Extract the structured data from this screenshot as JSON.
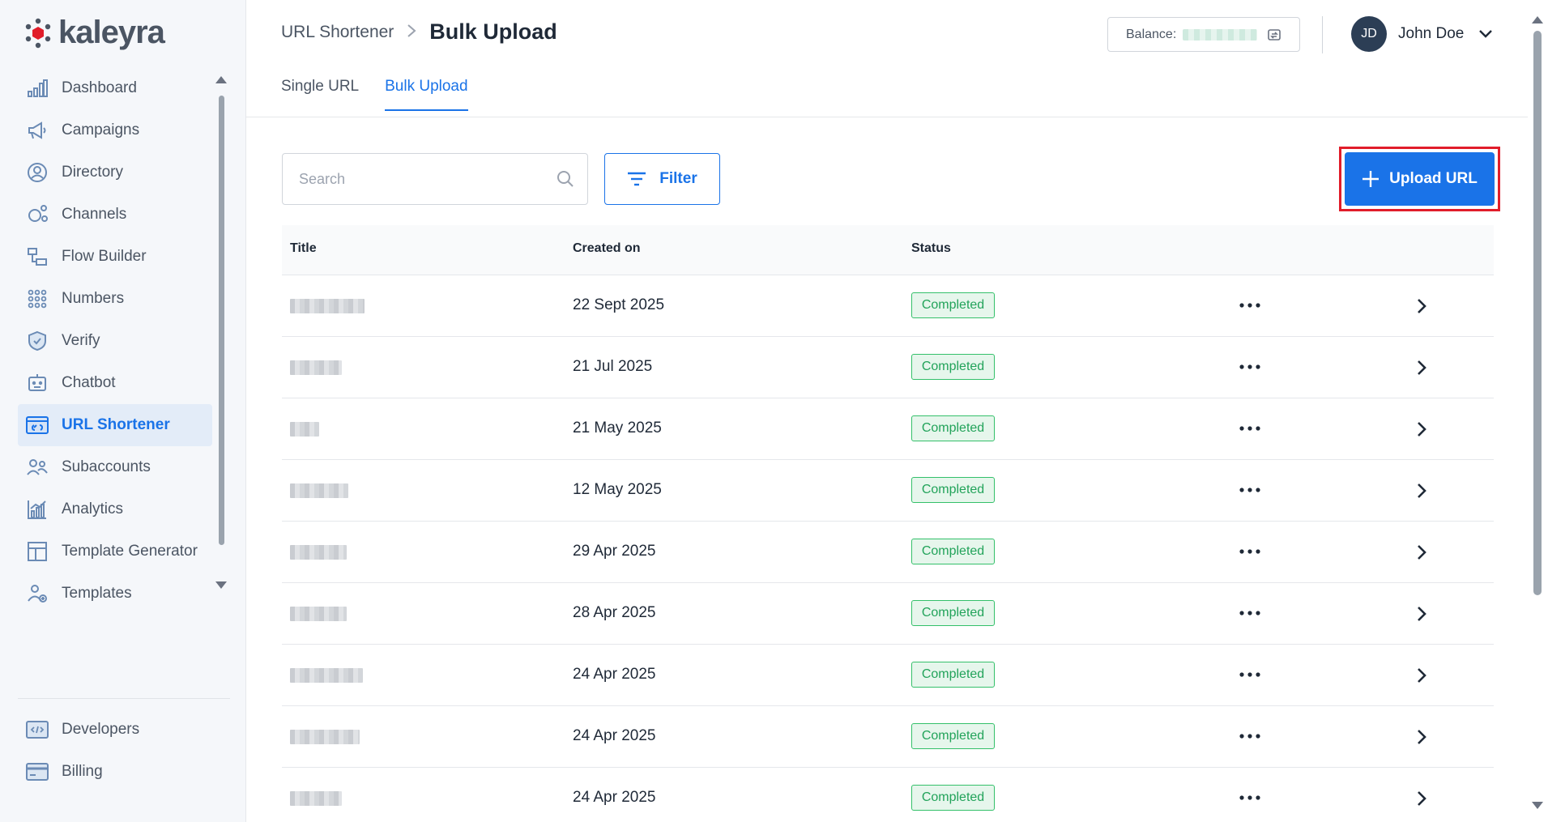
{
  "brand": {
    "name": "kaleyra",
    "color": "#4b5563",
    "mark_color": "#e11d2a"
  },
  "colors": {
    "accent": "#1a73e8",
    "success": "#22a35a",
    "highlight": "#e11d2a"
  },
  "sidebar": {
    "items": [
      {
        "label": "Dashboard",
        "icon": "bar-chart-icon"
      },
      {
        "label": "Campaigns",
        "icon": "megaphone-icon"
      },
      {
        "label": "Directory",
        "icon": "contact-icon"
      },
      {
        "label": "Channels",
        "icon": "channels-icon"
      },
      {
        "label": "Flow Builder",
        "icon": "flow-icon"
      },
      {
        "label": "Numbers",
        "icon": "dialpad-icon"
      },
      {
        "label": "Verify",
        "icon": "shield-icon"
      },
      {
        "label": "Chatbot",
        "icon": "bot-icon"
      },
      {
        "label": "URL Shortener",
        "icon": "link-icon",
        "active": true
      },
      {
        "label": "Subaccounts",
        "icon": "users-icon"
      },
      {
        "label": "Analytics",
        "icon": "analytics-icon"
      },
      {
        "label": "Template Generator",
        "icon": "template-generator-icon"
      },
      {
        "label": "Templates",
        "icon": "templates-icon"
      }
    ],
    "bottom_items": [
      {
        "label": "Developers",
        "icon": "code-icon"
      },
      {
        "label": "Billing",
        "icon": "card-icon"
      }
    ]
  },
  "header": {
    "breadcrumb_parent": "URL Shortener",
    "breadcrumb_separator": ">",
    "page_title": "Bulk Upload",
    "balance_label": "Balance:",
    "user": {
      "initials": "JD",
      "name": "John Doe"
    }
  },
  "tabs": [
    {
      "label": "Single URL",
      "active": false
    },
    {
      "label": "Bulk Upload",
      "active": true
    }
  ],
  "toolbar": {
    "search_placeholder": "Search",
    "search_value": "",
    "filter_label": "Filter",
    "upload_label": "Upload URL"
  },
  "table": {
    "columns": [
      "Title",
      "Created on",
      "Status"
    ],
    "rows": [
      {
        "created_on": "22 Sept 2025",
        "status": "Completed"
      },
      {
        "created_on": "21 Jul 2025",
        "status": "Completed"
      },
      {
        "created_on": "21 May 2025",
        "status": "Completed"
      },
      {
        "created_on": "12 May 2025",
        "status": "Completed"
      },
      {
        "created_on": "29 Apr 2025",
        "status": "Completed"
      },
      {
        "created_on": "28 Apr 2025",
        "status": "Completed"
      },
      {
        "created_on": "24 Apr 2025",
        "status": "Completed"
      },
      {
        "created_on": "24 Apr 2025",
        "status": "Completed"
      },
      {
        "created_on": "24 Apr 2025",
        "status": "Completed"
      }
    ]
  }
}
